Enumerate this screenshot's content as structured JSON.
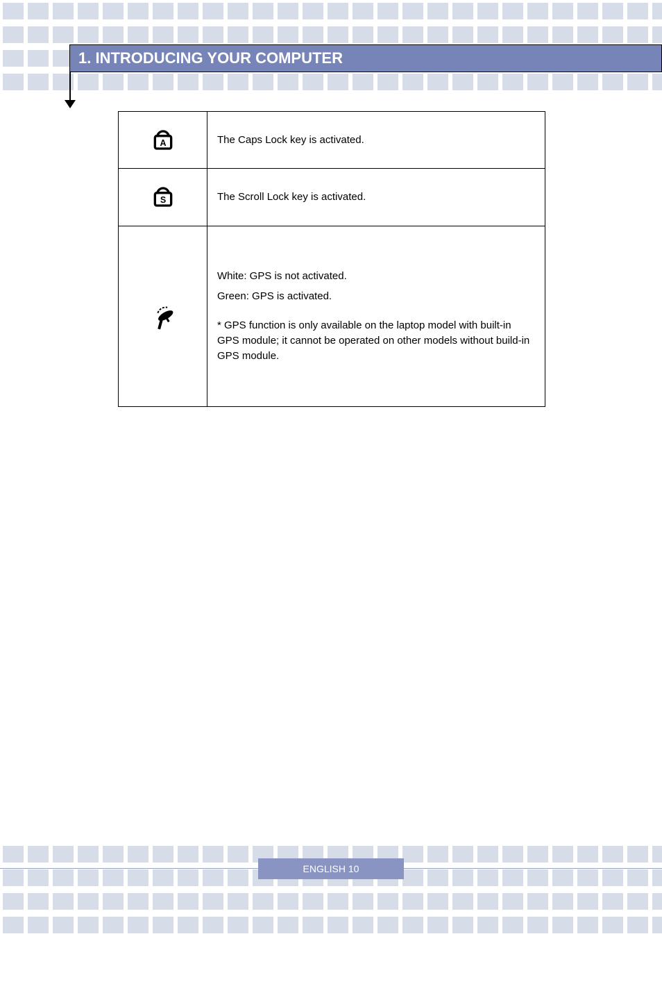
{
  "header": {
    "title": "1. INTRODUCING YOUR COMPUTER"
  },
  "table": {
    "rows": [
      {
        "icon": "caps-lock-icon",
        "text": "The Caps Lock key is activated."
      },
      {
        "icon": "scroll-lock-icon",
        "text": "The Scroll Lock key is activated."
      },
      {
        "icon": "satellite-icon",
        "text": "White: GPS is not activated.",
        "text2": "Green: GPS is activated.",
        "note": "* GPS function is only available on the laptop model with built-in GPS module; it cannot be operated on other models without build-in GPS module."
      }
    ]
  },
  "footer": {
    "page": "ENGLISH   10"
  }
}
